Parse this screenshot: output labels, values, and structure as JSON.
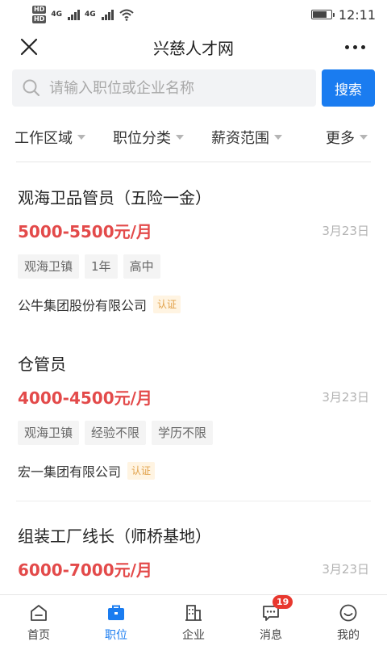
{
  "status_bar": {
    "hd1": "HD",
    "hd2": "HD",
    "net1": "4G",
    "net2": "4G",
    "time": "12:11"
  },
  "nav": {
    "title": "兴慈人才网"
  },
  "search": {
    "placeholder": "请输入职位或企业名称",
    "value": "",
    "button_label": "搜索"
  },
  "filters": [
    {
      "label": "工作区域"
    },
    {
      "label": "职位分类"
    },
    {
      "label": "薪资范围"
    },
    {
      "label": "更多"
    }
  ],
  "jobs": [
    {
      "title": "观海卫品管员（五险一金）",
      "salary": "5000-5500元/月",
      "date": "3月23日",
      "tags": [
        "观海卫镇",
        "1年",
        "高中"
      ],
      "company": "公牛集团股份有限公司",
      "badge": "认证"
    },
    {
      "title": "仓管员",
      "salary": "4000-4500元/月",
      "date": "3月23日",
      "tags": [
        "观海卫镇",
        "经验不限",
        "学历不限"
      ],
      "company": "宏一集团有限公司",
      "badge": "认证"
    },
    {
      "title": "组装工厂线长（师桥基地）",
      "salary": "6000-7000元/月",
      "date": "3月23日"
    }
  ],
  "tabbar": {
    "items": [
      {
        "label": "首页",
        "icon": "home-icon"
      },
      {
        "label": "职位",
        "icon": "briefcase-icon"
      },
      {
        "label": "企业",
        "icon": "building-icon"
      },
      {
        "label": "消息",
        "icon": "chat-icon"
      },
      {
        "label": "我的",
        "icon": "smiley-icon"
      }
    ],
    "message_count": "19"
  },
  "colors": {
    "accent": "#1a7cf0",
    "salary": "#e34a4a",
    "badge_text": "#e1a048",
    "badge_bg": "#fff4e2",
    "notification": "#e8382e"
  }
}
